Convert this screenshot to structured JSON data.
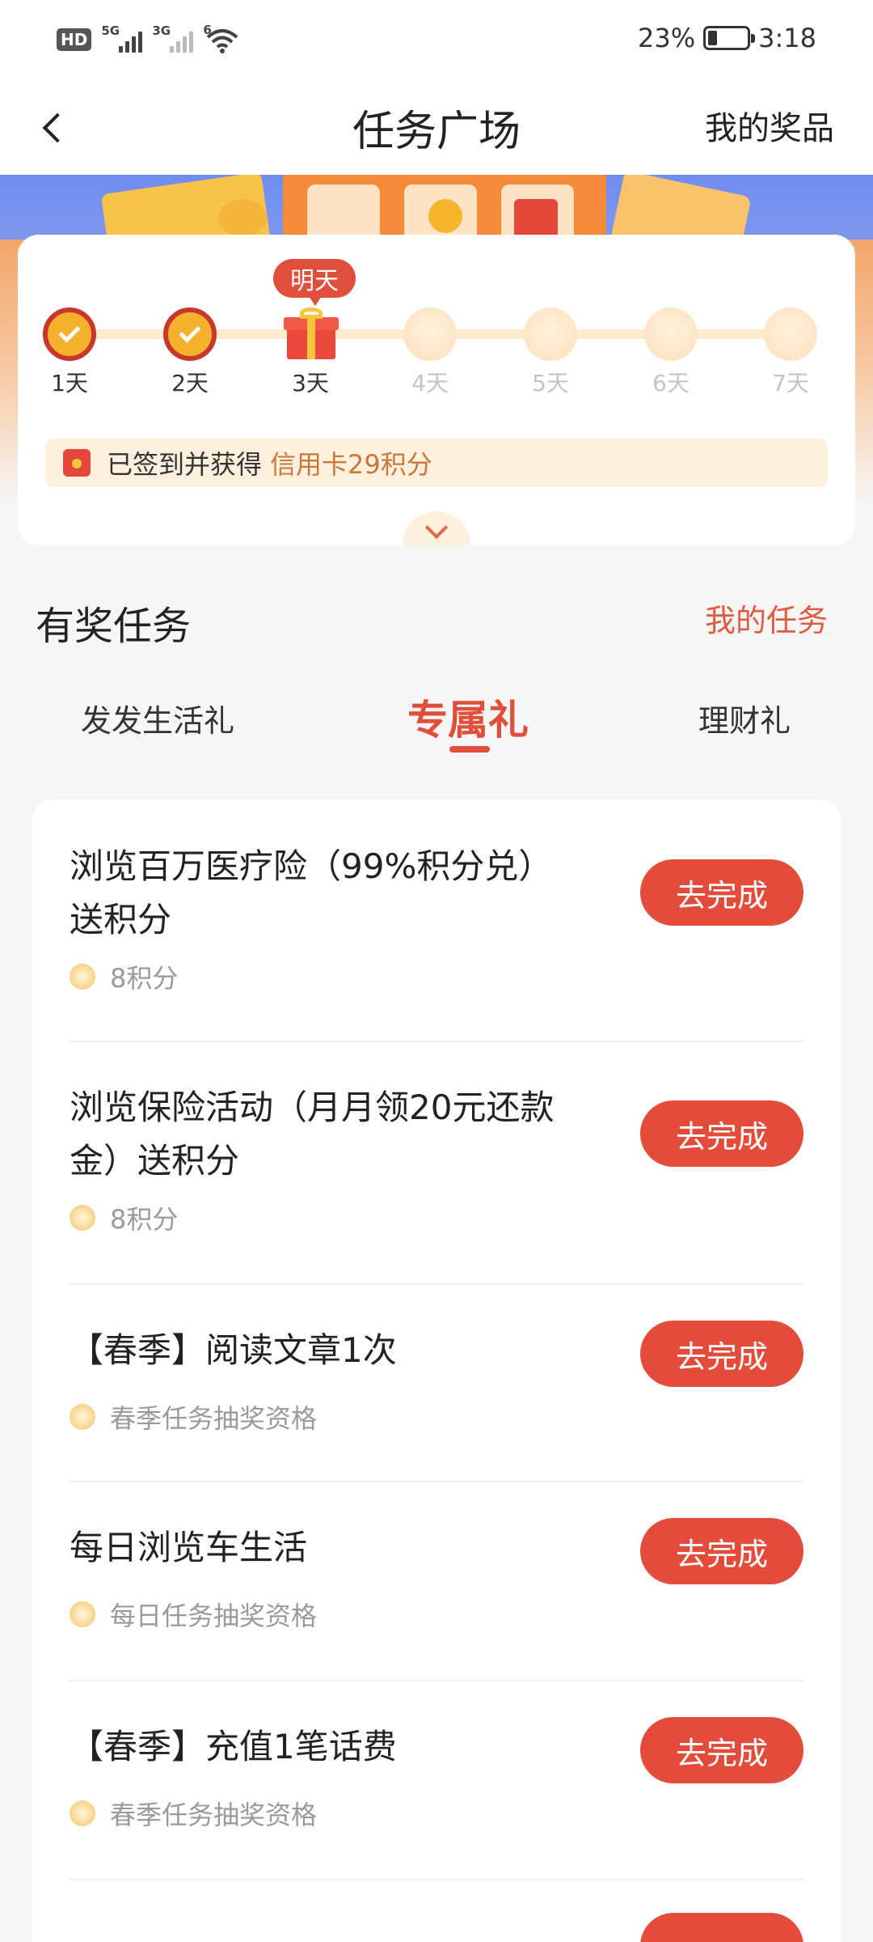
{
  "status_bar": {
    "hd": "HD",
    "sim1_net": "5G",
    "sim2_net": "3G",
    "wifi_net": "6",
    "battery_percent": "23%",
    "battery_level": 0.23,
    "time": "3:18"
  },
  "nav": {
    "title": "任务广场",
    "right_link": "我的奖品"
  },
  "checkin": {
    "days": [
      {
        "label": "1天",
        "state": "done"
      },
      {
        "label": "2天",
        "state": "done"
      },
      {
        "label": "3天",
        "state": "gift"
      },
      {
        "label": "4天",
        "state": "future"
      },
      {
        "label": "5天",
        "state": "future"
      },
      {
        "label": "6天",
        "state": "future"
      },
      {
        "label": "7天",
        "state": "future"
      }
    ],
    "tomorrow_tag": "明天",
    "notice_text": "已签到并获得",
    "notice_highlight": "信用卡29积分"
  },
  "rewards": {
    "title": "有奖任务",
    "my_tasks_link": "我的任务",
    "tabs": [
      {
        "label": "发发生活礼",
        "active": false
      },
      {
        "label": "专属礼",
        "active": true
      },
      {
        "label": "理财礼",
        "active": false
      }
    ],
    "tasks": [
      {
        "title": "浏览百万医疗险（99%积分兑）送积分",
        "reward": "8积分",
        "button": "去完成"
      },
      {
        "title": "浏览保险活动（月月领20元还款金）送积分",
        "reward": "8积分",
        "button": "去完成"
      },
      {
        "title": "【春季】阅读文章1次",
        "reward": "春季任务抽奖资格",
        "button": "去完成"
      },
      {
        "title": "每日浏览车生活",
        "reward": "每日任务抽奖资格",
        "button": "去完成"
      },
      {
        "title": "【春季】充值1笔话费",
        "reward": "春季任务抽奖资格",
        "button": "去完成"
      }
    ]
  },
  "colors": {
    "accent": "#e34c3b",
    "highlight_text": "#c9783a",
    "track": "#fdebd0"
  }
}
